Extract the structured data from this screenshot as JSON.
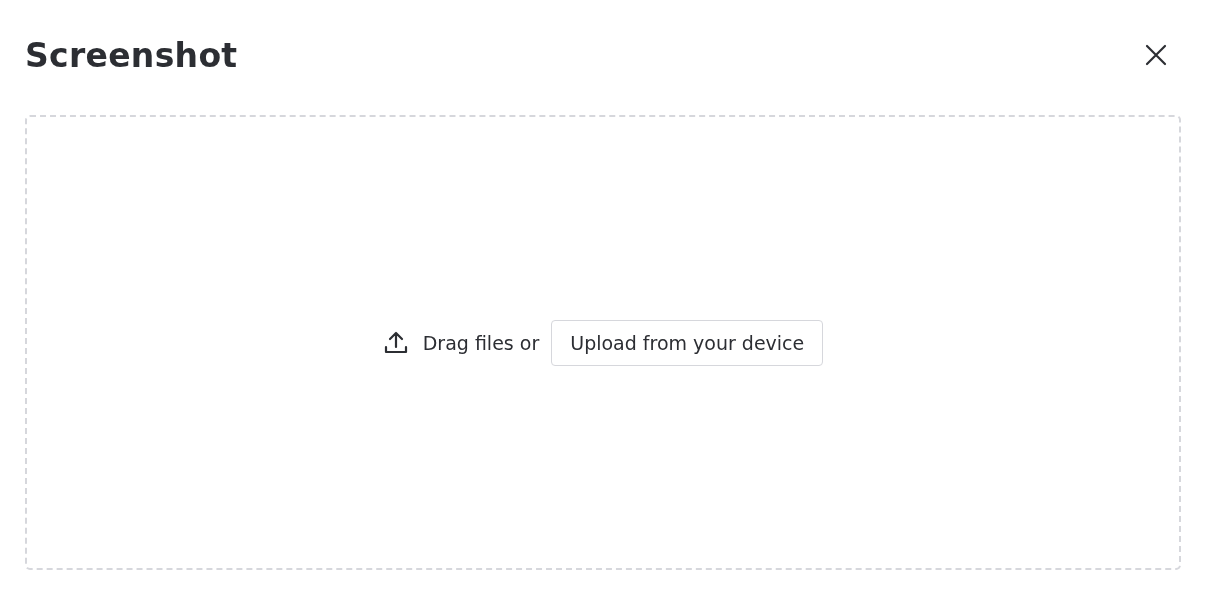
{
  "dialog": {
    "title": "Screenshot"
  },
  "dropzone": {
    "prompt": "Drag files or",
    "button": "Upload from your device"
  }
}
